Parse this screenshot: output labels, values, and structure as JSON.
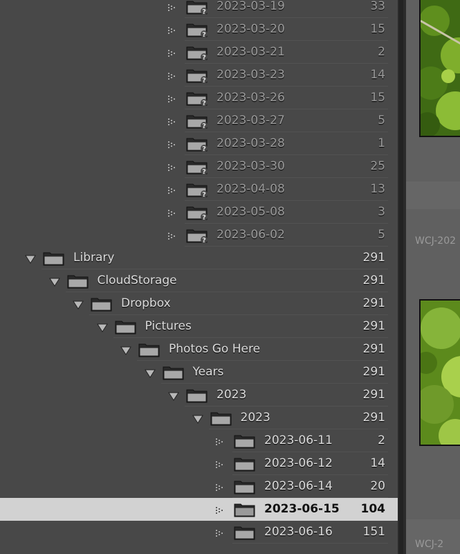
{
  "rows": [
    {
      "label": "2023-03-19",
      "count": "33",
      "level": 6,
      "missing": true,
      "expanded": null
    },
    {
      "label": "2023-03-20",
      "count": "15",
      "level": 6,
      "missing": true,
      "expanded": null
    },
    {
      "label": "2023-03-21",
      "count": "2",
      "level": 6,
      "missing": true,
      "expanded": null
    },
    {
      "label": "2023-03-23",
      "count": "14",
      "level": 6,
      "missing": true,
      "expanded": null
    },
    {
      "label": "2023-03-26",
      "count": "15",
      "level": 6,
      "missing": true,
      "expanded": null
    },
    {
      "label": "2023-03-27",
      "count": "5",
      "level": 6,
      "missing": true,
      "expanded": null
    },
    {
      "label": "2023-03-28",
      "count": "1",
      "level": 6,
      "missing": true,
      "expanded": null
    },
    {
      "label": "2023-03-30",
      "count": "25",
      "level": 6,
      "missing": true,
      "expanded": null
    },
    {
      "label": "2023-04-08",
      "count": "13",
      "level": 6,
      "missing": true,
      "expanded": null
    },
    {
      "label": "2023-05-08",
      "count": "3",
      "level": 6,
      "missing": true,
      "expanded": null
    },
    {
      "label": "2023-06-02",
      "count": "5",
      "level": 6,
      "missing": true,
      "expanded": null
    },
    {
      "label": "Library",
      "count": "291",
      "level": 0,
      "missing": false,
      "expanded": true
    },
    {
      "label": "CloudStorage",
      "count": "291",
      "level": 1,
      "missing": false,
      "expanded": true
    },
    {
      "label": "Dropbox",
      "count": "291",
      "level": 2,
      "missing": false,
      "expanded": true
    },
    {
      "label": "Pictures",
      "count": "291",
      "level": 3,
      "missing": false,
      "expanded": true
    },
    {
      "label": "Photos Go Here",
      "count": "291",
      "level": 4,
      "missing": false,
      "expanded": true
    },
    {
      "label": "Years",
      "count": "291",
      "level": 5,
      "missing": false,
      "expanded": true
    },
    {
      "label": "2023",
      "count": "291",
      "level": 6,
      "missing": false,
      "expanded": true
    },
    {
      "label": "2023",
      "count": "291",
      "level": 7,
      "missing": false,
      "expanded": true
    },
    {
      "label": "2023-06-11",
      "count": "2",
      "level": 8,
      "missing": false,
      "expanded": null
    },
    {
      "label": "2023-06-12",
      "count": "14",
      "level": 8,
      "missing": false,
      "expanded": null
    },
    {
      "label": "2023-06-14",
      "count": "20",
      "level": 8,
      "missing": false,
      "expanded": null
    },
    {
      "label": "2023-06-15",
      "count": "104",
      "level": 8,
      "missing": false,
      "expanded": null,
      "selected": true
    },
    {
      "label": "2023-06-16",
      "count": "151",
      "level": 8,
      "missing": false,
      "expanded": null
    }
  ],
  "grid": {
    "captions": [
      "WCJ-202",
      "WCJ-2"
    ]
  },
  "colors": {
    "panel": "#484848",
    "selected": "#d2d2d2",
    "foliage": "#6f9a2a"
  }
}
